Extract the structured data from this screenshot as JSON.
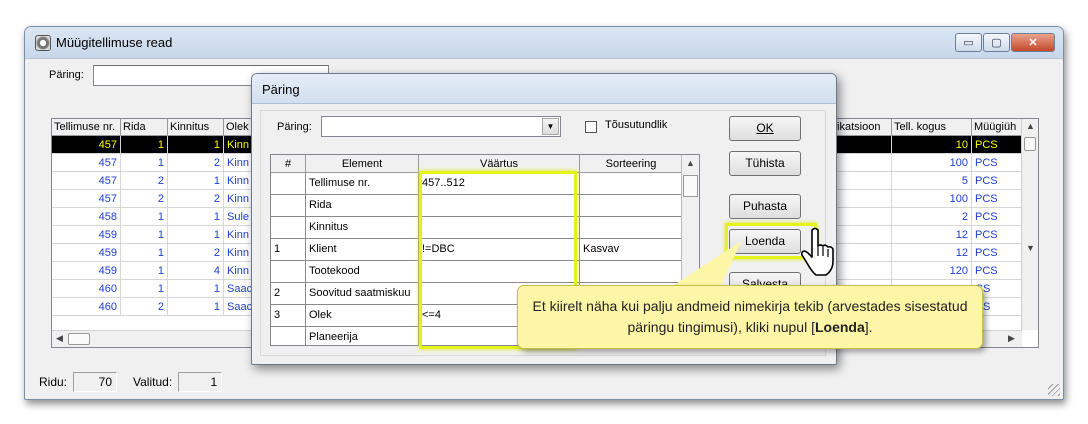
{
  "window": {
    "title": "Müügitellimuse read",
    "query_label": "Päring:",
    "buttons": {
      "minimize": "▭",
      "maximize": "▢",
      "close": "✕"
    }
  },
  "grid": {
    "columns": [
      "Tellimuse nr.",
      "Rida",
      "Kinnitus",
      "Olek",
      "fikatsioon",
      "Tell. kogus",
      "Müügiüh"
    ],
    "rows": [
      {
        "order": "457",
        "line": "1",
        "conf": "1",
        "state": "Kinn",
        "qty": "10",
        "unit": "PCS",
        "selected": true
      },
      {
        "order": "457",
        "line": "1",
        "conf": "2",
        "state": "Kinn",
        "qty": "100",
        "unit": "PCS"
      },
      {
        "order": "457",
        "line": "2",
        "conf": "1",
        "state": "Kinn",
        "qty": "5",
        "unit": "PCS"
      },
      {
        "order": "457",
        "line": "2",
        "conf": "2",
        "state": "Kinn",
        "qty": "100",
        "unit": "PCS"
      },
      {
        "order": "458",
        "line": "1",
        "conf": "1",
        "state": "Sule",
        "qty": "2",
        "unit": "PCS"
      },
      {
        "order": "459",
        "line": "1",
        "conf": "1",
        "state": "Kinn",
        "qty": "12",
        "unit": "PCS"
      },
      {
        "order": "459",
        "line": "1",
        "conf": "2",
        "state": "Kinn",
        "qty": "12",
        "unit": "PCS"
      },
      {
        "order": "459",
        "line": "1",
        "conf": "4",
        "state": "Kinn",
        "qty": "120",
        "unit": "PCS"
      },
      {
        "order": "460",
        "line": "1",
        "conf": "1",
        "state": "Saac",
        "qty": "",
        "unit": "CS"
      },
      {
        "order": "460",
        "line": "2",
        "conf": "1",
        "state": "Saac",
        "qty": "",
        "unit": "CS"
      }
    ]
  },
  "status": {
    "rows_label": "Ridu:",
    "rows_value": "70",
    "selected_label": "Valitud:",
    "selected_value": "1"
  },
  "dialog": {
    "title": "Päring",
    "query_label": "Päring:",
    "checkbox_label": "Tõusutundlik",
    "columns": [
      "#",
      "Element",
      "Väärtus",
      "Sorteering"
    ],
    "rows": [
      {
        "num": "",
        "element": "Tellimuse nr.",
        "value": "457..512",
        "sort": ""
      },
      {
        "num": "",
        "element": "Rida",
        "value": "",
        "sort": ""
      },
      {
        "num": "",
        "element": "Kinnitus",
        "value": "",
        "sort": ""
      },
      {
        "num": "1",
        "element": "Klient",
        "value": "!=DBC",
        "sort": "Kasvav"
      },
      {
        "num": "",
        "element": "Tootekood",
        "value": "",
        "sort": ""
      },
      {
        "num": "2",
        "element": "Soovitud saatmiskuu",
        "value": "",
        "sort": ""
      },
      {
        "num": "3",
        "element": "Olek",
        "value": "<=4",
        "sort": ""
      },
      {
        "num": "",
        "element": "Planeerija",
        "value": "",
        "sort": ""
      }
    ],
    "buttons": {
      "ok": "OK",
      "cancel": "Tühista",
      "clear": "Puhasta",
      "count": "Loenda",
      "save": "Salvesta"
    }
  },
  "callout": {
    "text_before": "Et kiirelt näha kui palju andmeid nimekirja tekib (arvestades sisestatud päringu tingimusi), kliki nupul [",
    "text_bold": "Loenda",
    "text_after": "]."
  },
  "colors": {
    "highlight": "#e6f21c",
    "callout_bg": "#fdf6a6",
    "grid_text": "#1e3ecf",
    "selected_text": "#ffff00"
  }
}
